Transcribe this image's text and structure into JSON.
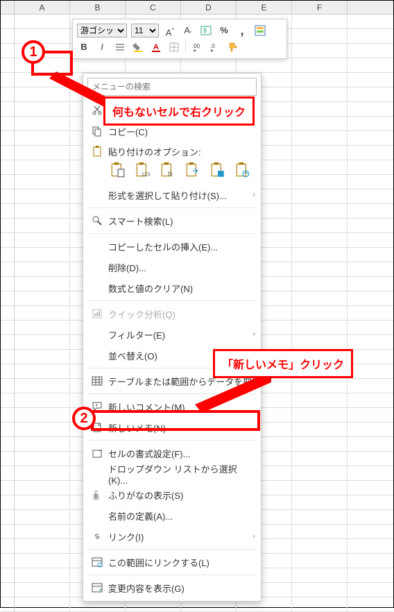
{
  "columns": [
    "A",
    "B",
    "C",
    "D",
    "E",
    "F"
  ],
  "mini_toolbar": {
    "font_family_value": "游ゴシック",
    "font_size_value": "11",
    "increase_font_tip": "A^",
    "decrease_font_tip": "A_",
    "bold": "B",
    "italic": "I"
  },
  "context_menu": {
    "search_placeholder": "メニューの検索",
    "cut": "切り取り(T)",
    "copy": "コピー(C)",
    "paste_options_label": "貼り付けのオプション:",
    "paste_special": "形式を選択して貼り付け(S)...",
    "smart_lookup": "スマート検索(L)",
    "insert_copied": "コピーしたセルの挿入(E)...",
    "delete": "削除(D)...",
    "clear": "数式と値のクリア(N)",
    "quick_analysis": "クイック分析(Q)",
    "filter": "フィルター(E)",
    "sort": "並べ替え(O)",
    "table_from_range": "テーブルまたは範囲からデータを取得(G)...",
    "new_comment": "新しいコメント(M)",
    "new_note": "新しいメモ(N)",
    "format_cells": "セルの書式設定(F)...",
    "dropdown_pick": "ドロップダウン リストから選択(K)...",
    "phonetic": "ふりがなの表示(S)",
    "define_name": "名前の定義(A)...",
    "link": "リンク(I)",
    "link_to_range": "この範囲にリンクする(L)",
    "show_changes": "変更内容を表示(G)"
  },
  "annotations": {
    "step1_num": "1",
    "step1_text": "何もないセルで右クリック",
    "step2_num": "2",
    "step2_text": "「新しいメモ」クリック"
  }
}
